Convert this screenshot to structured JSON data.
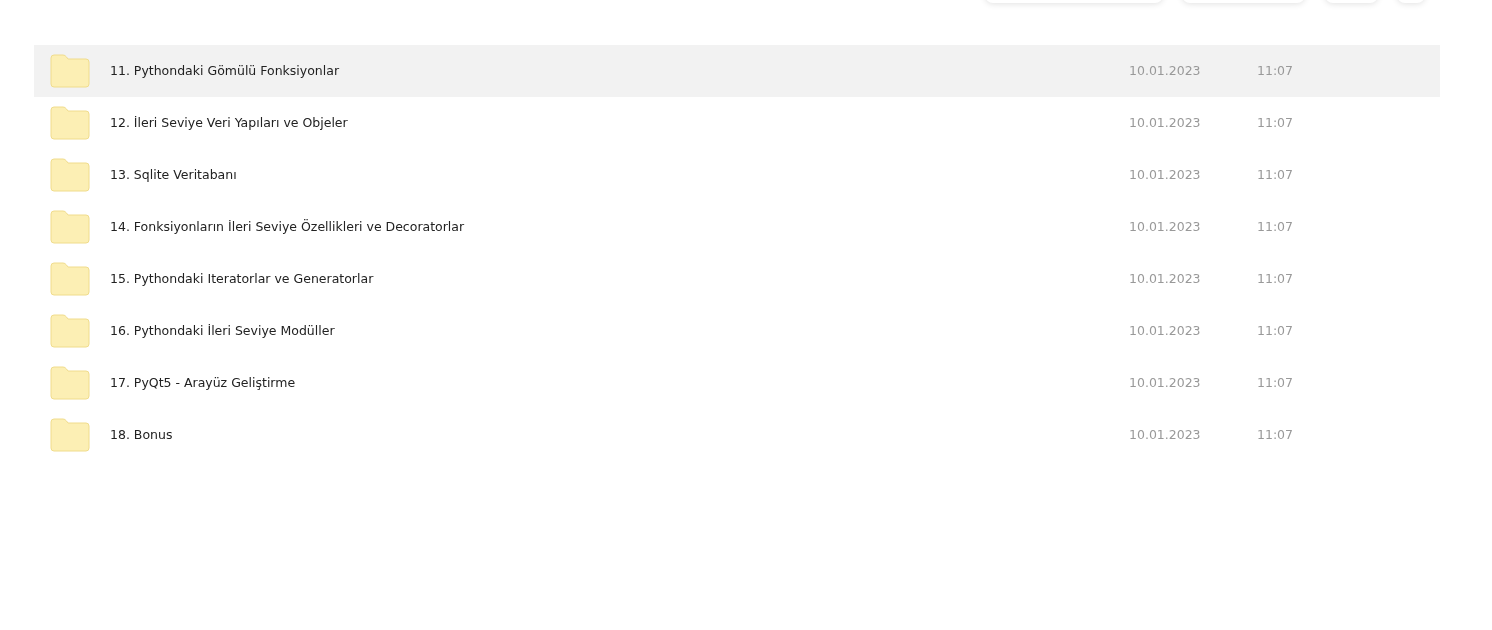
{
  "rows": [
    {
      "name": "11. Pythondaki Gömülü Fonksiyonlar",
      "date": "10.01.2023",
      "time": "11:07",
      "selected": true
    },
    {
      "name": "12. İleri Seviye Veri Yapıları ve Objeler",
      "date": "10.01.2023",
      "time": "11:07",
      "selected": false
    },
    {
      "name": "13. Sqlite Veritabanı",
      "date": "10.01.2023",
      "time": "11:07",
      "selected": false
    },
    {
      "name": "14. Fonksiyonların İleri Seviye Özellikleri ve Decoratorlar",
      "date": "10.01.2023",
      "time": "11:07",
      "selected": false
    },
    {
      "name": "15. Pythondaki Iteratorlar ve Generatorlar",
      "date": "10.01.2023",
      "time": "11:07",
      "selected": false
    },
    {
      "name": "16. Pythondaki İleri Seviye Modüller",
      "date": "10.01.2023",
      "time": "11:07",
      "selected": false
    },
    {
      "name": "17. PyQt5 - Arayüz Geliştirme",
      "date": "10.01.2023",
      "time": "11:07",
      "selected": false
    },
    {
      "name": "18. Bonus",
      "date": "10.01.2023",
      "time": "11:07",
      "selected": false
    }
  ]
}
